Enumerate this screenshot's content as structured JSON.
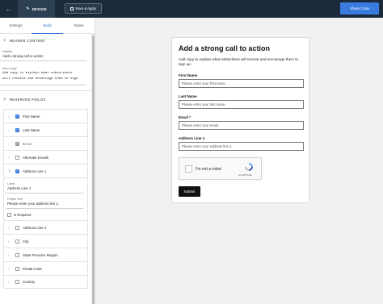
{
  "topbar": {
    "design_label": "DESIGN",
    "save_label": "Save & Apply",
    "share_label": "Share Code"
  },
  "panel": {
    "tabs": [
      "Settings",
      "Build",
      "Styles"
    ],
    "active_tab": "Build",
    "header_section": {
      "title": "HEADER CONTENT",
      "header_label": "Header",
      "header_value": "Add a strong call to action",
      "intro_label": "Intro Copy",
      "intro_value": "Add copy to explain what subscribers\nwill receive and encourage them to sign"
    },
    "reserved_section": {
      "title": "RESERVED FIELDS",
      "fields": [
        {
          "label": "First Name",
          "state": "checked"
        },
        {
          "label": "Last Name",
          "state": "checked"
        },
        {
          "label": "Email",
          "state": "locked"
        },
        {
          "label": "Alternate Emails",
          "state": "unchecked"
        },
        {
          "label": "Address Line 1",
          "state": "checked"
        }
      ],
      "expanded": {
        "label_caption": "Label",
        "label_value": "Address Line 1",
        "helper_caption": "Helper Text",
        "helper_value": "Please enter your address line 1.",
        "required_label": "Is Required"
      },
      "more_fields": [
        {
          "label": "Address Line 2",
          "state": "unchecked"
        },
        {
          "label": "City",
          "state": "unchecked"
        },
        {
          "label": "State Province Region",
          "state": "unchecked"
        },
        {
          "label": "Postal Code",
          "state": "unchecked"
        },
        {
          "label": "Country",
          "state": "unchecked"
        }
      ]
    }
  },
  "preview": {
    "title": "Add a strong call to action",
    "intro": "Add copy to explain what subscribers will receive and encourage them to sign up.",
    "fields": [
      {
        "label": "First Name",
        "placeholder": "Please enter your first name."
      },
      {
        "label": "Last Name",
        "placeholder": "Please enter your last name."
      },
      {
        "label": "Email *",
        "placeholder": "Please enter your email."
      },
      {
        "label": "Address Line 1",
        "placeholder": "Please enter your address line 1."
      }
    ],
    "captcha_text": "I'm not a robot",
    "captcha_brand": "reCAPTCHA",
    "submit_label": "Submit"
  },
  "colors": {
    "topbar": "#1c2b3a",
    "accent": "#3a7be0",
    "active_tab": "#2b6fd6"
  }
}
